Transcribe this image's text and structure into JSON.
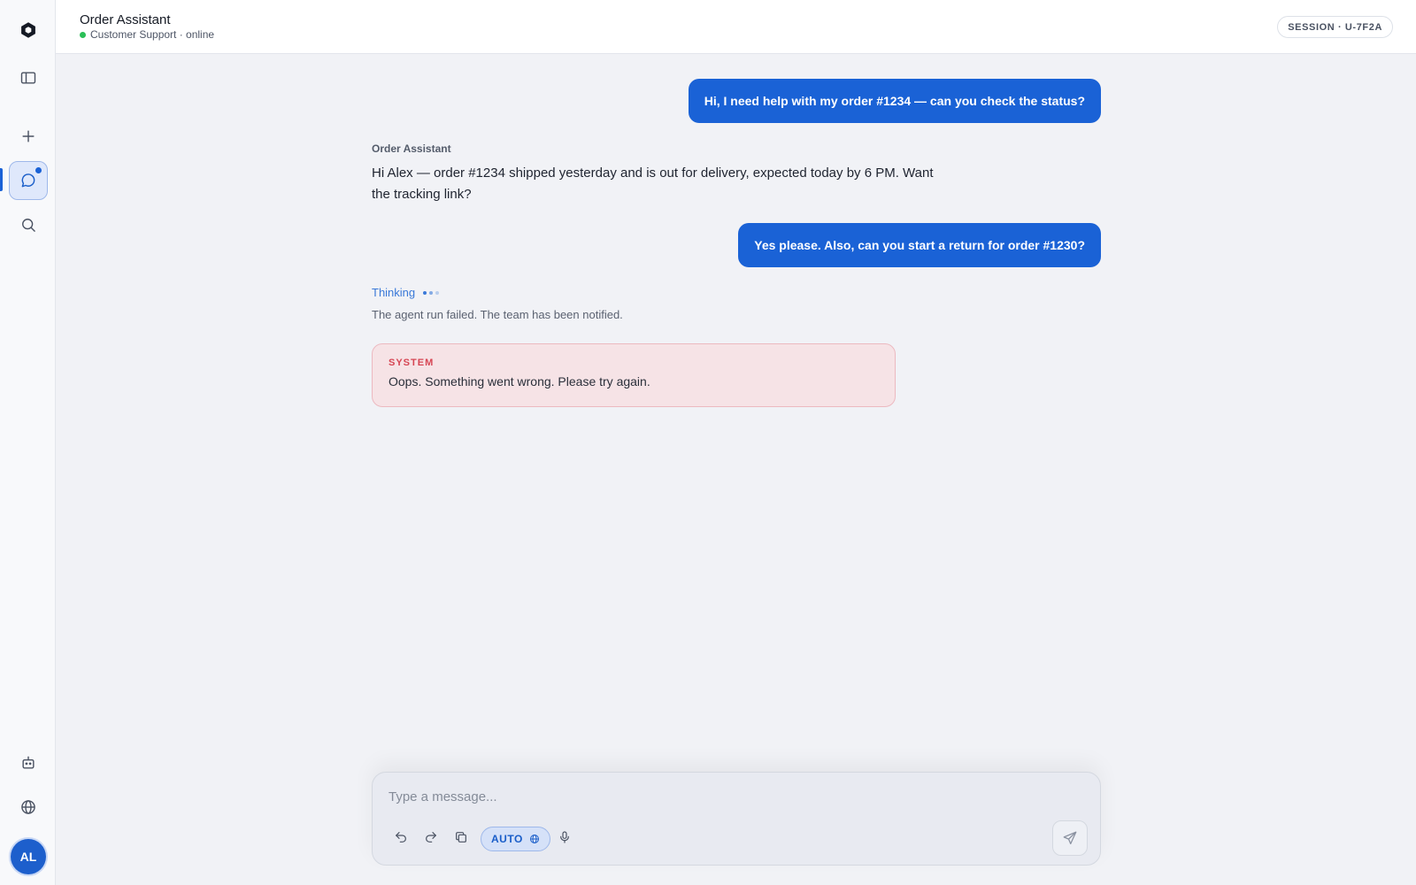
{
  "header": {
    "title": "Order Assistant",
    "subtitle": "Customer Support · online",
    "session": "SESSION · U-7F2A"
  },
  "sidebar": {
    "items": [
      {
        "icon": "logo-icon"
      },
      {
        "icon": "panel-toggle-icon"
      },
      {
        "icon": "plus-icon"
      },
      {
        "icon": "chat-icon",
        "active": true
      },
      {
        "icon": "search-icon"
      },
      {
        "icon": "robot-icon"
      },
      {
        "icon": "globe-icon"
      }
    ],
    "avatar_initials": "AL"
  },
  "chat": {
    "messages": [
      {
        "role": "user",
        "text": "Hi, I need help with my order #1234 — can you check the status?"
      },
      {
        "role": "assistant",
        "name": "Order Assistant",
        "text": "Hi Alex — order #1234 shipped yesterday and is out for delivery, expected today by 6 PM. Want the tracking link?"
      },
      {
        "role": "user",
        "text": "Yes please. Also, can you start a return for order #1230?"
      }
    ],
    "thinking_label": "Thinking",
    "fail_text": "The agent run failed. The team has been notified.",
    "error": {
      "label": "SYSTEM",
      "message": "Oops. Something went wrong. Please try again."
    }
  },
  "composer": {
    "placeholder": "Type a message...",
    "value": "",
    "auto_label": "AUTO"
  },
  "colors": {
    "accent": "#1a62d6",
    "error_bg": "#f6e3e6",
    "error_label": "#d64553",
    "online": "#2bbf57"
  }
}
